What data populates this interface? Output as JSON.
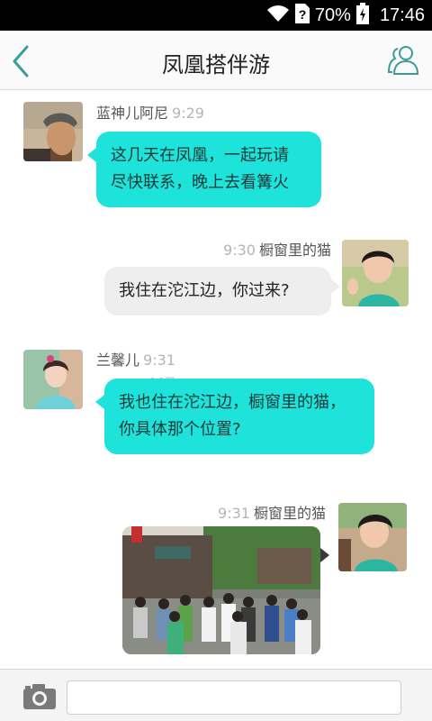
{
  "status_bar": {
    "battery": "70%",
    "time": "17:46",
    "icons": [
      "wifi-icon",
      "sim-unknown-icon",
      "battery-charging-icon"
    ]
  },
  "header": {
    "title": "凤凰搭伴游",
    "back_icon": "chevron-left-icon",
    "members_icon": "people-icon"
  },
  "messages": [
    {
      "direction": "in",
      "sender": "蓝神儿阿尼",
      "time": "9:29",
      "text": "这几天在凤凰，一起玩请\n尽快联系，晚上去看篝火"
    },
    {
      "direction": "out",
      "sender": "橱窗里的猫",
      "time": "9:30",
      "text": "我住在沱江边，你过来?"
    },
    {
      "direction": "in",
      "sender": "兰馨儿",
      "time": "9:31",
      "text": "我也住在沱江边，橱窗里的猫，\n你具体那个位置?"
    },
    {
      "direction": "out",
      "sender": "橱窗里的猫",
      "time": "9:31",
      "type": "image"
    }
  ],
  "floating_label": "16日",
  "composer": {
    "camera_icon": "camera-icon",
    "input_value": "",
    "input_placeholder": ""
  },
  "colors": {
    "incoming_bubble": "#1ee3db",
    "outgoing_bubble": "#eeeeee",
    "accent_icon": "#3a9c94"
  }
}
